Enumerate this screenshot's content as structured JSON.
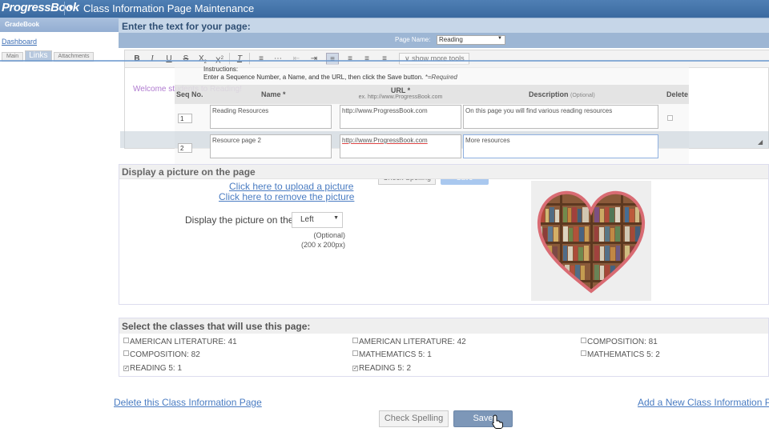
{
  "app": {
    "logo": "ProgressBook",
    "title": "Class Information Page Maintenance"
  },
  "sidebar": {
    "section": "GradeBook",
    "dashboard": "Dashboard",
    "tabs": [
      "Main",
      "Links",
      "Attachments"
    ],
    "active_tab": "Links"
  },
  "editor": {
    "header": "Enter the text for your page:",
    "page_name_label": "Page Name:",
    "page_name_value": "Reading",
    "more_tools": "show more tools",
    "content": "Welcome students to Reading!"
  },
  "links": {
    "instructions_title": "Instructions:",
    "instructions_text": "Enter a Sequence Number, a Name, and the URL, then click the Save button.",
    "required_note": "*=Required",
    "columns": {
      "seq": "Seq No.",
      "name": "Name *",
      "url": "URL *",
      "url_example": "ex. http://www.ProgressBook.com",
      "description": "Description",
      "description_note": "(Optional)",
      "delete": "Delete"
    },
    "rows": [
      {
        "seq": "1",
        "name": "Reading Resources",
        "url": "http://www.ProgressBook.com",
        "description": "On this page you will find various reading resources"
      },
      {
        "seq": "2",
        "name": "Resource page 2",
        "url": "http://www.ProgressBook.com",
        "description": "More resources"
      }
    ],
    "check_spelling": "Check Spelling",
    "save": "Save"
  },
  "picture": {
    "header": "Display a picture on the page",
    "upload_link": "Click here to upload a picture",
    "remove_link": "Click here to remove the picture",
    "display_label": "Display the picture on the",
    "position_value": "Left",
    "optional": "(Optional)",
    "dimensions": "(200 x 200px)",
    "image_icon": "heart-bookshelf-image"
  },
  "classes": {
    "header": "Select the classes that will use this page:",
    "items": [
      {
        "label": "AMERICAN LITERATURE: 41",
        "checked": false
      },
      {
        "label": "AMERICAN LITERATURE: 42",
        "checked": false
      },
      {
        "label": "COMPOSITION: 81",
        "checked": false
      },
      {
        "label": "COMPOSITION: 82",
        "checked": false
      },
      {
        "label": "MATHEMATICS 5: 1",
        "checked": false
      },
      {
        "label": "MATHEMATICS 5: 2",
        "checked": false
      },
      {
        "label": "READING 5: 1",
        "checked": true
      },
      {
        "label": "READING 5: 2",
        "checked": true
      }
    ]
  },
  "footer": {
    "delete_link": "Delete this Class Information Page",
    "add_link": "Add a New Class Information Page",
    "check_spelling": "Check Spelling",
    "save": "Save"
  },
  "colors": {
    "header_blue": "#3b6aa0",
    "link_blue": "#4a7cc2",
    "save_button": "#7d97b8"
  }
}
